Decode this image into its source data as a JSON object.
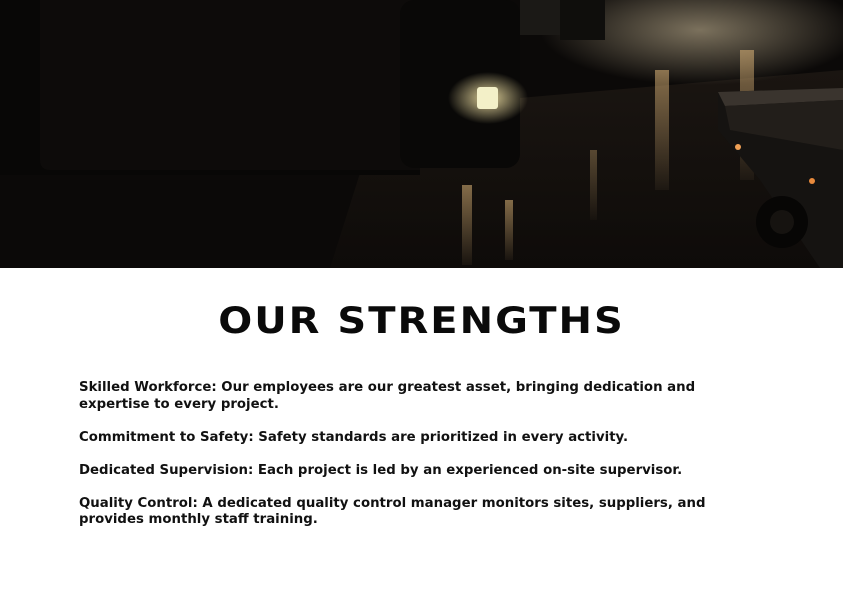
{
  "page": {
    "title": "OUR STRENGTHS",
    "strengths": [
      {
        "text": "Skilled Workforce: Our employees are our greatest asset, bringing dedication and expertise to every project."
      },
      {
        "text": "Commitment to Safety: Safety standards are prioritized in every activity."
      },
      {
        "text": "Dedicated Supervision: Each project is led by an experienced on-site supervisor."
      },
      {
        "text": "Quality Control: A dedicated quality control manager monitors sites, suppliers, and provides monthly staff training."
      }
    ]
  },
  "colors": {
    "text": "#111111",
    "background": "#ffffff",
    "photo_dark": "#0c0a09",
    "light_amber": "#e8c98a"
  }
}
